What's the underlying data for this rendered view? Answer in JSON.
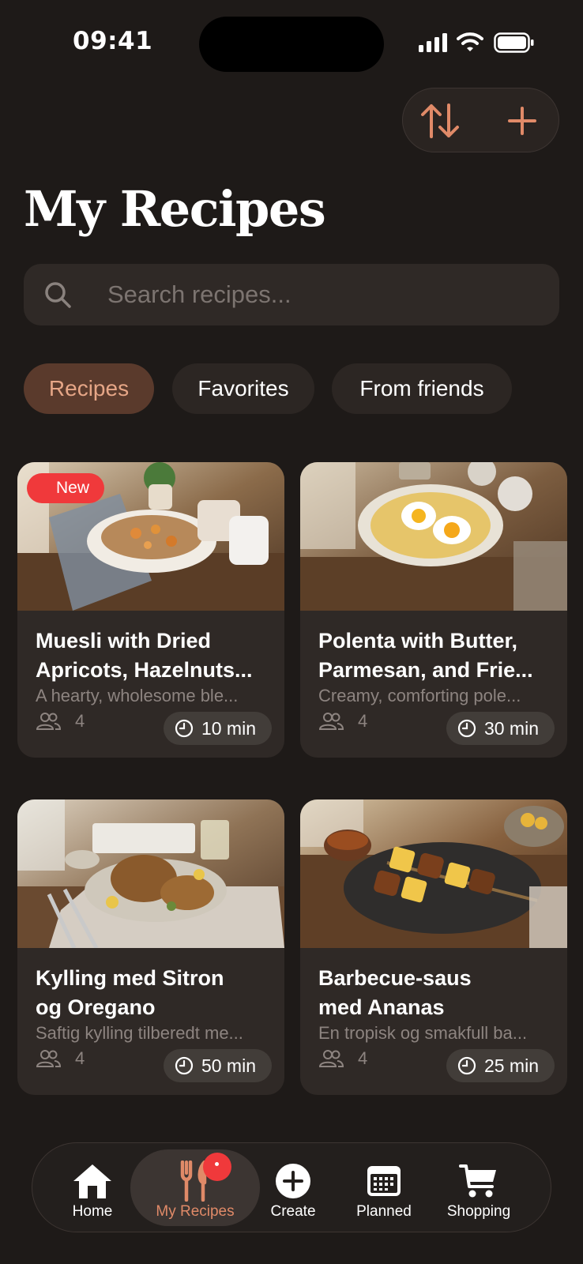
{
  "status_bar": {
    "time": "09:41"
  },
  "header": {
    "title": "My Recipes",
    "sort_icon": "sort-arrows-icon",
    "add_icon": "plus-icon"
  },
  "search": {
    "placeholder": "Search recipes..."
  },
  "tabs": [
    {
      "label": "Recipes",
      "active": true
    },
    {
      "label": "Favorites",
      "active": false
    },
    {
      "label": "From friends",
      "active": false
    }
  ],
  "recipes": [
    {
      "title": "Muesli with Dried Apricots, Hazelnuts...",
      "title_line1": "Muesli with Dried",
      "title_line2": "Apricots, Hazelnuts...",
      "description": "A hearty, wholesome ble...",
      "time": "10 min",
      "servings": "4",
      "badge": "New"
    },
    {
      "title": "Polenta with Butter, Parmesan, and Frie...",
      "title_line1": "Polenta with Butter,",
      "title_line2": "Parmesan, and Frie...",
      "description": "Creamy, comforting pole...",
      "time": "30 min",
      "servings": "4"
    },
    {
      "title": "Kylling med Sitron og Oregano",
      "title_line1": "Kylling med Sitron",
      "title_line2": "og Oregano",
      "description": "Saftig kylling tilberedt me...",
      "time": "50 min",
      "servings": "4"
    },
    {
      "title": "Barbecue-saus med Ananas",
      "title_line1": "Barbecue-saus",
      "title_line2": "med Ananas",
      "description": "En tropisk og smakfull ba...",
      "time": "25 min",
      "servings": "4"
    }
  ],
  "nav": [
    {
      "label": "Home",
      "icon": "home-icon"
    },
    {
      "label": "My Recipes",
      "icon": "fork-knife-icon",
      "active": true
    },
    {
      "label": "Create",
      "icon": "plus-circle-icon"
    },
    {
      "label": "Planned",
      "icon": "calendar-icon"
    },
    {
      "label": "Shopping",
      "icon": "cart-icon"
    }
  ],
  "colors": {
    "background": "#1e1a18",
    "card": "#2f2926",
    "accent": "#e08a68",
    "badge": "#f0393b",
    "active_tab_bg": "#5a3a2c"
  }
}
